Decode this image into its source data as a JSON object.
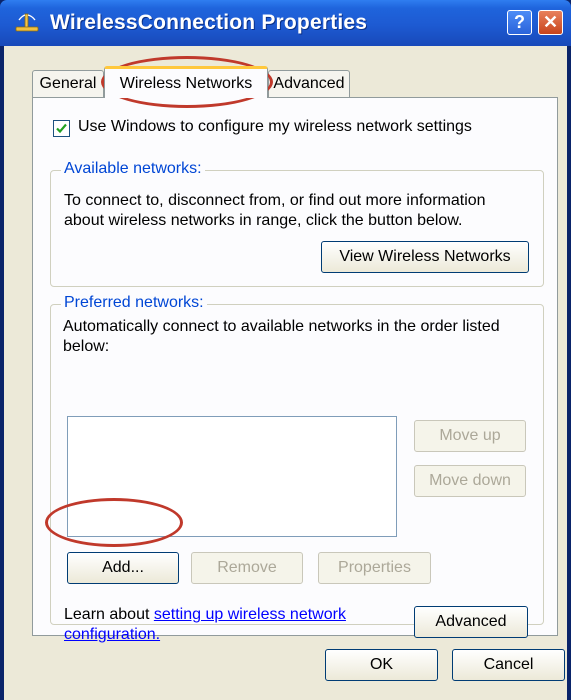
{
  "window": {
    "title": "WirelessConnection Properties",
    "help_glyph": "?",
    "close_glyph": "✕"
  },
  "tabs": [
    {
      "label": "General"
    },
    {
      "label": "Wireless Networks",
      "active": true
    },
    {
      "label": "Advanced"
    }
  ],
  "checkbox": {
    "label": "Use Windows to configure my wireless network settings",
    "checked": true
  },
  "available": {
    "legend": "Available networks:",
    "line1": "To connect to, disconnect from, or find out more information",
    "line2": "about wireless networks in range, click the button below.",
    "view_button": "View Wireless Networks"
  },
  "preferred": {
    "legend": "Preferred networks:",
    "line1": "Automatically connect to available networks in the order listed",
    "line2": "below:",
    "move_up": "Move up",
    "move_down": "Move down",
    "add": "Add...",
    "remove": "Remove",
    "properties": "Properties"
  },
  "learn": {
    "prefix": "Learn about ",
    "link_part1": "setting up wireless network",
    "link_part2": "configuration.",
    "advanced_button": "Advanced"
  },
  "footer": {
    "ok": "OK",
    "cancel": "Cancel"
  },
  "colors": {
    "titlebar": "#1d5ad2",
    "dialog_bg": "#ece9d8",
    "group_legend": "#0046d5",
    "annotation_ring": "#c0392b"
  }
}
